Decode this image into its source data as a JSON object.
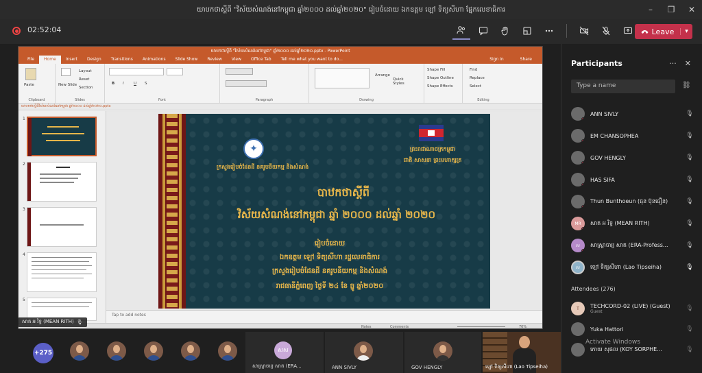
{
  "window": {
    "title": "យាបកថាស្តីពី \"វិស័យសំណង់នៅកម្ពុជា ឆ្នាំ២០០០ ដល់ឆ្នាំ២០២០\" រៀបចំដោយ ឯកឧត្តម ឡៅ ទិត្យសីហា ផ្នែកលេខាធិការ",
    "controls": [
      "–",
      "❐",
      "✕"
    ]
  },
  "meeting": {
    "timer": "02:52:04",
    "leave_label": "Leave",
    "toolbar_icons": [
      "participants-icon",
      "chat-icon",
      "raise-hand-icon",
      "rooms-icon",
      "more-icon",
      "camera-off-icon",
      "mic-off-icon",
      "share-icon"
    ]
  },
  "ppt": {
    "title": "យាបកថាស្តីពី \"វិស័យសំណង់នៅកម្ពុជា\" ឆ្នាំ២០០០ ដល់ឆ្នាំ២០២០.pptx - PowerPoint",
    "tabs": [
      "File",
      "Home",
      "Insert",
      "Design",
      "Transitions",
      "Animations",
      "Slide Show",
      "Review",
      "View",
      "Office Tab",
      "Tell me what you want to do..."
    ],
    "signin": "Sign in",
    "share": "Share",
    "ribbon": {
      "paste": "Paste",
      "new_slide": "New Slide",
      "layout": "Layout",
      "reset": "Reset",
      "section": "Section",
      "arrange": "Arrange",
      "quick_styles": "Quick Styles",
      "shape_fill": "Shape Fill",
      "shape_outline": "Shape Outline",
      "shape_effects": "Shape Effects",
      "find": "Find",
      "replace": "Replace",
      "select": "Select",
      "groups": [
        "Clipboard",
        "Slides",
        "Font",
        "Paragraph",
        "Drawing",
        "Editing"
      ]
    },
    "file_tab": "យាបកថាស្តីពីវិស័យសំណង់នៅកម្ពុជា ឆ្នាំ២០០០ ដល់ឆ្នាំ២០២០.pptx",
    "slide_numbers": [
      "1",
      "2",
      "3",
      "4",
      "5"
    ],
    "notes_placeholder": "Tap to add notes",
    "status": {
      "notes": "Notes",
      "comments": "Comments",
      "zoom": "70%"
    }
  },
  "slide": {
    "ministry": "ក្រសួងរៀបចំដែនដី នគរូបនីយកម្ម និងសំណង់",
    "kingdom": "ព្រះរាជាណាចក្រកម្ពុជា",
    "motto": "ជាតិ សាសនា ព្រះមហាក្សត្រ",
    "heading": "បាឋកថាស្តីពី",
    "topic": "វិស័យសំណង់នៅកម្ពុជា ឆ្នាំ ២០០០ ដល់ឆ្នាំ ២០២០",
    "by": "រៀបចំដោយ",
    "presenter": "ឯកឧត្តម ឡៅ ទិត្យសីហា រដ្ឋលេខាធិការ",
    "ministry2": "ក្រសួងរៀបចំដែនដី នគរូបនីយកម្ម និងសំណង់",
    "date": "រាជធានីភ្នំពេញ ថ្ងៃទី ២៤ ខែ ធ្នូ ឆ្នាំ២០២០"
  },
  "speaker_tag": "សាត អ រិទ្ធ (MEAN RITH)",
  "participants": {
    "title": "Participants",
    "search_placeholder": "Type a name",
    "list": [
      {
        "name": "ANN SIVLY",
        "initials": "",
        "sub": ""
      },
      {
        "name": "EM CHANSOPHEA",
        "initials": "",
        "sub": ""
      },
      {
        "name": "GOV HENGLY",
        "initials": "",
        "sub": ""
      },
      {
        "name": "HAS SIFA",
        "initials": "",
        "sub": ""
      },
      {
        "name": "Thun Bunthoeun (ធុន ប៊ុនធឿន)",
        "initials": "",
        "sub": ""
      },
      {
        "name": "សាត អ រិទ្ធ (MEAN RITH)",
        "initials": "MR",
        "sub": ""
      },
      {
        "name": "សាស្រ្តាចារ្យ សាត (ERA-Profess...",
        "initials": "ស",
        "sub": ""
      },
      {
        "name": "ឡៅ ទិត្យសីហា (Lao Tipseiha)",
        "initials": "ស",
        "sub": ""
      }
    ],
    "attendees_label": "Attendees (276)",
    "attendees": [
      {
        "name": "TECHCORD-02 (LIVE) (Guest)",
        "initials": "T",
        "sub": "Guest"
      },
      {
        "name": "Yuka Hattori",
        "initials": "",
        "sub": ""
      },
      {
        "name": "កោយ សុផល (KOY SORPHE...",
        "initials": "",
        "sub": ""
      }
    ]
  },
  "gallery": {
    "count": "+275",
    "tiles": [
      {
        "name": "សាស្រ្តាចារ្យ សាត (ERA...",
        "initials": "សស"
      },
      {
        "name": "ANN SIVLY",
        "initials": ""
      },
      {
        "name": "GOV HENGLY",
        "initials": ""
      }
    ],
    "video_name": "ឡៅ ទិត្យសីហា (Lao Tipseiha)"
  },
  "watermark": "Activate Windows"
}
